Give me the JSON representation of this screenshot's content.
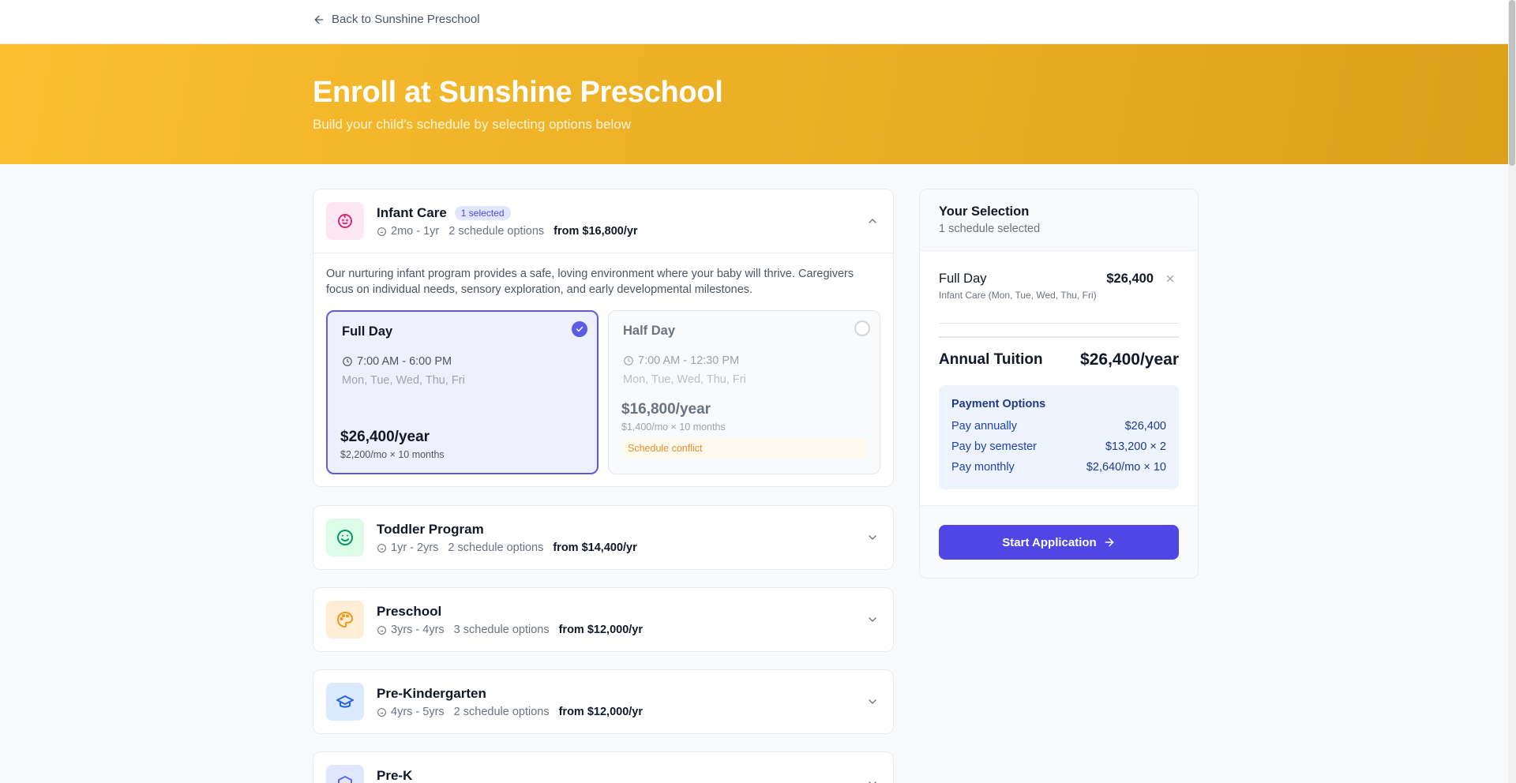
{
  "nav": {
    "back_label": "Back to Sunshine Preschool"
  },
  "hero": {
    "title": "Enroll at Sunshine Preschool",
    "subtitle": "Build your child's schedule by selecting options below"
  },
  "programs": [
    {
      "name": "Infant Care",
      "badge": "1 selected",
      "age": "2mo - 1yr",
      "options_count": "2 schedule options",
      "from_price": "from $16,800/yr",
      "icon": "baby-icon",
      "icon_color": "#db2777",
      "icon_bg": "#fce7f3",
      "expanded": true,
      "description": "Our nurturing infant program provides a safe, loving environment where your baby will thrive. Caregivers focus on individual needs, sensory exploration, and early developmental milestones.",
      "options": [
        {
          "name": "Full Day",
          "time": "7:00 AM - 6:00 PM",
          "days": "Mon, Tue, Wed, Thu, Fri",
          "price": "$26,400/year",
          "monthly": "$2,200/mo × 10 months",
          "selected": true
        },
        {
          "name": "Half Day",
          "time": "7:00 AM - 12:30 PM",
          "days": "Mon, Tue, Wed, Thu, Fri",
          "price": "$16,800/year",
          "monthly": "$1,400/mo × 10 months",
          "conflict": "Schedule conflict",
          "selected": false
        }
      ]
    },
    {
      "name": "Toddler Program",
      "age": "1yr - 2yrs",
      "options_count": "2 schedule options",
      "from_price": "from $14,400/yr",
      "icon": "smile-icon",
      "icon_color": "#059669",
      "icon_bg": "#dcfce7"
    },
    {
      "name": "Preschool",
      "age": "3yrs - 4yrs",
      "options_count": "3 schedule options",
      "from_price": "from $12,000/yr",
      "icon": "palette-icon",
      "icon_color": "#ea9a1a",
      "icon_bg": "#ffedd5"
    },
    {
      "name": "Pre-Kindergarten",
      "age": "4yrs - 5yrs",
      "options_count": "2 schedule options",
      "from_price": "from $12,000/yr",
      "icon": "graduation-cap-icon",
      "icon_color": "#2563eb",
      "icon_bg": "#dbeafe"
    },
    {
      "name": "Pre-K",
      "icon": "shield-icon",
      "icon_color": "#6366f1",
      "icon_bg": "#e0e7ff"
    }
  ],
  "summary": {
    "title": "Your Selection",
    "subtitle": "1 schedule selected",
    "item": {
      "name": "Full Day",
      "sub": "Infant Care  (Mon, Tue, Wed, Thu, Fri)",
      "amount": "$26,400"
    },
    "total_label": "Annual Tuition",
    "total_value": "$26,400/year",
    "payment": {
      "title": "Payment Options",
      "rows": [
        {
          "label": "Pay annually",
          "value": "$26,400"
        },
        {
          "label": "Pay by semester",
          "value": "$13,200 × 2"
        },
        {
          "label": "Pay monthly",
          "value": "$2,640/mo × 10"
        }
      ]
    },
    "cta_label": "Start Application"
  }
}
